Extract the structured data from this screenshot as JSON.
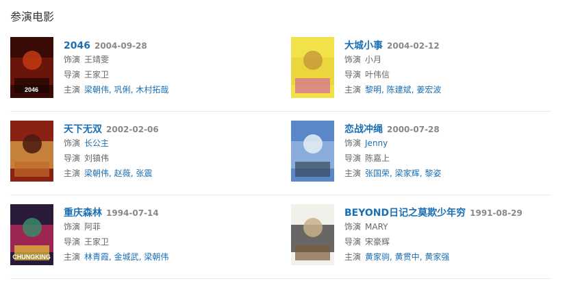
{
  "section_title": "参演电影",
  "labels": {
    "role": "饰演",
    "director": "导演",
    "starring": "主演"
  },
  "movies": [
    {
      "title": "2046",
      "date": "2004-09-28",
      "role": "王靖雯",
      "role_link": false,
      "director": "王家卫",
      "director_link": false,
      "starring": [
        "梁朝伟",
        "巩俐",
        "木村拓哉"
      ],
      "poster_colors": [
        "#3a0a06",
        "#7a1a0c",
        "#c23a14",
        "#1a0503"
      ],
      "poster_text": "2046"
    },
    {
      "title": "大城小事",
      "date": "2004-02-12",
      "role": "小月",
      "role_link": false,
      "director": "叶伟信",
      "director_link": false,
      "starring": [
        "黎明",
        "陈建斌",
        "姜宏波"
      ],
      "poster_colors": [
        "#f2e24a",
        "#e9d23a",
        "#c89a3c",
        "#d46a9a"
      ],
      "poster_text": ""
    },
    {
      "title": "天下无双",
      "date": "2002-02-06",
      "role": "长公主",
      "role_link": true,
      "director": "刘镇伟",
      "director_link": false,
      "starring": [
        "梁朝伟",
        "赵薇",
        "张震"
      ],
      "poster_colors": [
        "#8a2214",
        "#d8a04a",
        "#4a1a10",
        "#c06a2a"
      ],
      "poster_text": ""
    },
    {
      "title": "恋战冲绳",
      "date": "2000-07-28",
      "role": "Jenny",
      "role_link": true,
      "director": "陈嘉上",
      "director_link": false,
      "starring": [
        "张国荣",
        "梁家辉",
        "黎姿"
      ],
      "poster_colors": [
        "#5a87c8",
        "#9cb9e4",
        "#e8eef6",
        "#3a4a5a"
      ],
      "poster_text": ""
    },
    {
      "title": "重庆森林",
      "date": "1994-07-14",
      "role": "阿菲",
      "role_link": false,
      "director": "王家卫",
      "director_link": false,
      "starring": [
        "林青霞",
        "金城武",
        "梁朝伟"
      ],
      "poster_colors": [
        "#2a1a3a",
        "#c42a5a",
        "#3a8a6a",
        "#e8c43a"
      ],
      "poster_text": "CHUNGKING"
    },
    {
      "title": "BEYOND日记之莫欺少年穷",
      "date": "1991-08-29",
      "role": "MARY",
      "role_link": false,
      "director": "宋豪辉",
      "director_link": false,
      "starring": [
        "黄家驹",
        "黄贯中",
        "黄家强"
      ],
      "poster_colors": [
        "#f2f0ea",
        "#3a3a3a",
        "#c8b08a",
        "#7a5a3a"
      ],
      "poster_text": ""
    }
  ]
}
